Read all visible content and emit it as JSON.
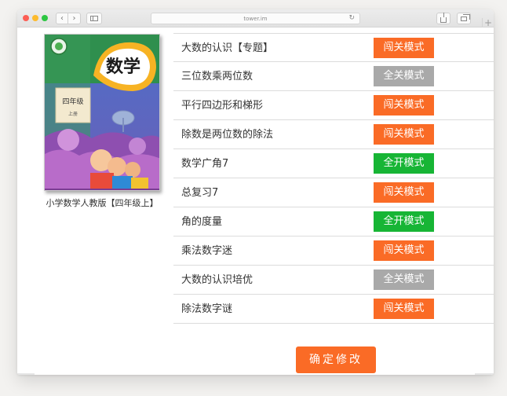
{
  "browser": {
    "url": "tower.im",
    "back_label": "‹",
    "forward_label": "›",
    "reload_label": "↻",
    "newtab_label": "+"
  },
  "book": {
    "caption": "小学数学人教版【四年级上】",
    "cover_title": "数学",
    "cover_grade": "四年级",
    "cover_volume": "上册"
  },
  "lessons": [
    {
      "name": "大数的认识【专题】",
      "mode": "闯关模式",
      "mode_color": "#fa6b26"
    },
    {
      "name": "三位数乘两位数",
      "mode": "全关模式",
      "mode_color": "#a9a9a9"
    },
    {
      "name": "平行四边形和梯形",
      "mode": "闯关模式",
      "mode_color": "#fa6b26"
    },
    {
      "name": "除数是两位数的除法",
      "mode": "闯关模式",
      "mode_color": "#fa6b26"
    },
    {
      "name": "数学广角7",
      "mode": "全开模式",
      "mode_color": "#17b535"
    },
    {
      "name": "总复习7",
      "mode": "闯关模式",
      "mode_color": "#fa6b26"
    },
    {
      "name": "角的度量",
      "mode": "全开模式",
      "mode_color": "#17b535"
    },
    {
      "name": "乘法数字迷",
      "mode": "闯关模式",
      "mode_color": "#fa6b26"
    },
    {
      "name": "大数的认识培优",
      "mode": "全关模式",
      "mode_color": "#a9a9a9"
    },
    {
      "name": "除法数字谜",
      "mode": "闯关模式",
      "mode_color": "#fa6b26"
    }
  ],
  "confirm_label": "确定修改",
  "colors": {
    "accent_orange": "#fa6b26",
    "mode_gray": "#a9a9a9",
    "mode_green": "#17b535"
  }
}
